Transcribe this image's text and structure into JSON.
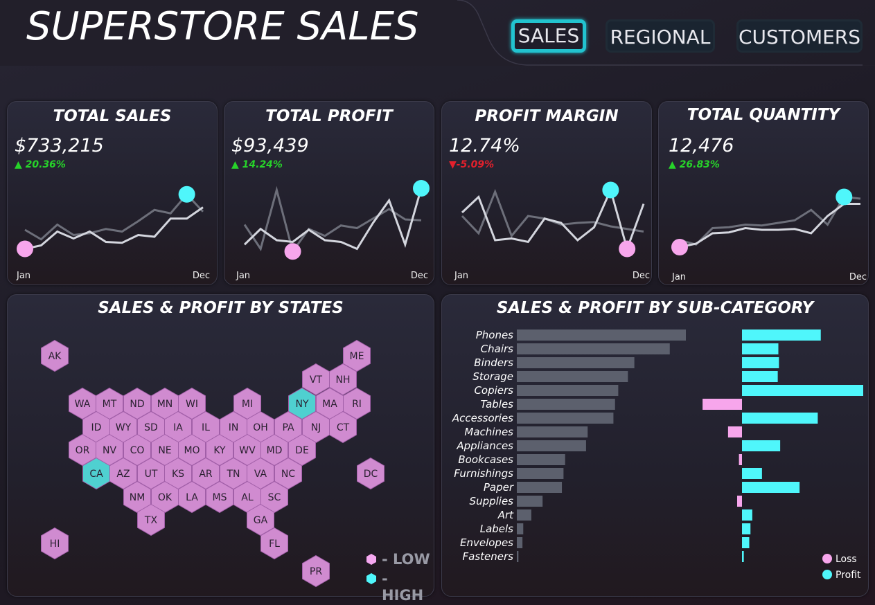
{
  "header": {
    "title": "SUPERSTORE SALES",
    "nav": [
      {
        "label": "SALES",
        "active": true
      },
      {
        "label": "REGIONAL",
        "active": false
      },
      {
        "label": "CUSTOMERS",
        "active": false
      }
    ]
  },
  "kpis": [
    {
      "title": "TOTAL SALES",
      "value": "$733,215",
      "change": "▲ 20.36%",
      "trend": "up",
      "month_start": "Jan",
      "month_end": "Dec",
      "current": [
        0.1,
        0.14,
        0.3,
        0.22,
        0.3,
        0.18,
        0.17,
        0.26,
        0.24,
        0.45,
        0.45,
        0.58
      ],
      "previous": [
        0.32,
        0.21,
        0.38,
        0.26,
        0.28,
        0.33,
        0.3,
        0.42,
        0.55,
        0.51,
        0.73,
        0.53
      ]
    },
    {
      "title": "TOTAL PROFIT",
      "value": "$93,439",
      "change": "▲ 14.24%",
      "trend": "up",
      "month_start": "Jan",
      "month_end": "Dec",
      "current": [
        0.15,
        0.33,
        0.2,
        0.18,
        0.32,
        0.2,
        0.18,
        0.1,
        0.4,
        0.66,
        0.15,
        0.8
      ],
      "previous": [
        0.38,
        0.1,
        0.78,
        0.07,
        0.33,
        0.25,
        0.37,
        0.34,
        0.45,
        0.56,
        0.44,
        0.43
      ]
    },
    {
      "title": "PROFIT MARGIN",
      "value": "12.74%",
      "change": "▼-5.09%",
      "trend": "down",
      "month_start": "Jan",
      "month_end": "Dec",
      "current": [
        0.52,
        0.7,
        0.2,
        0.22,
        0.18,
        0.45,
        0.4,
        0.2,
        0.35,
        0.78,
        0.1,
        0.62
      ],
      "previous": [
        0.48,
        0.28,
        0.76,
        0.25,
        0.48,
        0.45,
        0.38,
        0.4,
        0.41,
        0.36,
        0.33,
        0.3
      ]
    },
    {
      "title": "TOTAL QUANTITY",
      "value": "12,476",
      "change": "▲ 26.83%",
      "trend": "up",
      "month_start": "Jan",
      "month_end": "Dec",
      "current": [
        0.12,
        0.16,
        0.28,
        0.29,
        0.34,
        0.32,
        0.32,
        0.33,
        0.28,
        0.48,
        0.62,
        0.62
      ],
      "previous": [
        0.2,
        0.15,
        0.34,
        0.35,
        0.38,
        0.37,
        0.4,
        0.43,
        0.55,
        0.38,
        0.7,
        0.68
      ]
    }
  ],
  "states_map": {
    "title": "SALES & PROFIT BY STATES",
    "legend": {
      "low_label": "- LOW",
      "high_label": "- HIGH",
      "low_color": "#d08bd0",
      "high_color": "#4fd0d0"
    },
    "states": [
      {
        "code": "AK",
        "level": "low"
      },
      {
        "code": "ME",
        "level": "low"
      },
      {
        "code": "VT",
        "level": "low"
      },
      {
        "code": "NH",
        "level": "low"
      },
      {
        "code": "WA",
        "level": "low"
      },
      {
        "code": "MT",
        "level": "low"
      },
      {
        "code": "ND",
        "level": "low"
      },
      {
        "code": "MN",
        "level": "low"
      },
      {
        "code": "WI",
        "level": "low"
      },
      {
        "code": "MI",
        "level": "low"
      },
      {
        "code": "NY",
        "level": "high"
      },
      {
        "code": "MA",
        "level": "low"
      },
      {
        "code": "RI",
        "level": "low"
      },
      {
        "code": "ID",
        "level": "low"
      },
      {
        "code": "WY",
        "level": "low"
      },
      {
        "code": "SD",
        "level": "low"
      },
      {
        "code": "IA",
        "level": "low"
      },
      {
        "code": "IL",
        "level": "low"
      },
      {
        "code": "IN",
        "level": "low"
      },
      {
        "code": "OH",
        "level": "low"
      },
      {
        "code": "PA",
        "level": "low"
      },
      {
        "code": "NJ",
        "level": "low"
      },
      {
        "code": "CT",
        "level": "low"
      },
      {
        "code": "OR",
        "level": "low"
      },
      {
        "code": "NV",
        "level": "low"
      },
      {
        "code": "CO",
        "level": "low"
      },
      {
        "code": "NE",
        "level": "low"
      },
      {
        "code": "MO",
        "level": "low"
      },
      {
        "code": "KY",
        "level": "low"
      },
      {
        "code": "WV",
        "level": "low"
      },
      {
        "code": "MD",
        "level": "low"
      },
      {
        "code": "DE",
        "level": "low"
      },
      {
        "code": "CA",
        "level": "high"
      },
      {
        "code": "AZ",
        "level": "low"
      },
      {
        "code": "UT",
        "level": "low"
      },
      {
        "code": "KS",
        "level": "low"
      },
      {
        "code": "AR",
        "level": "low"
      },
      {
        "code": "TN",
        "level": "low"
      },
      {
        "code": "VA",
        "level": "low"
      },
      {
        "code": "NC",
        "level": "low"
      },
      {
        "code": "DC",
        "level": "low"
      },
      {
        "code": "NM",
        "level": "low"
      },
      {
        "code": "OK",
        "level": "low"
      },
      {
        "code": "LA",
        "level": "low"
      },
      {
        "code": "MS",
        "level": "low"
      },
      {
        "code": "AL",
        "level": "low"
      },
      {
        "code": "SC",
        "level": "low"
      },
      {
        "code": "TX",
        "level": "low"
      },
      {
        "code": "GA",
        "level": "low"
      },
      {
        "code": "HI",
        "level": "low"
      },
      {
        "code": "FL",
        "level": "low"
      },
      {
        "code": "PR",
        "level": "low"
      }
    ]
  },
  "chart_data": {
    "type": "bar",
    "title": "SALES & PROFIT BY SUB-CATEGORY",
    "categories": [
      "Phones",
      "Chairs",
      "Binders",
      "Storage",
      "Copiers",
      "Tables",
      "Accessories",
      "Machines",
      "Appliances",
      "Bookcases",
      "Furnishings",
      "Paper",
      "Supplies",
      "Art",
      "Labels",
      "Envelopes",
      "Fasteners"
    ],
    "series": [
      {
        "name": "Sales",
        "values": [
          105000,
          95000,
          73000,
          69000,
          63000,
          61000,
          60000,
          44000,
          43000,
          30000,
          29000,
          28000,
          16000,
          9000,
          4000,
          3500,
          1000
        ]
      },
      {
        "name": "Profit",
        "values": [
          13000,
          6000,
          6100,
          5900,
          20000,
          -6500,
          12500,
          -2300,
          6300,
          -500,
          3300,
          9500,
          -800,
          1700,
          1400,
          1200,
          300
        ]
      }
    ],
    "legend": [
      {
        "label": "Loss",
        "color": "#f7a6ec"
      },
      {
        "label": "Profit",
        "color": "#4ff6fb"
      }
    ],
    "colors": {
      "sales": "#5c606d",
      "profit": "#4ff6fb",
      "loss": "#f7a6ec"
    }
  }
}
